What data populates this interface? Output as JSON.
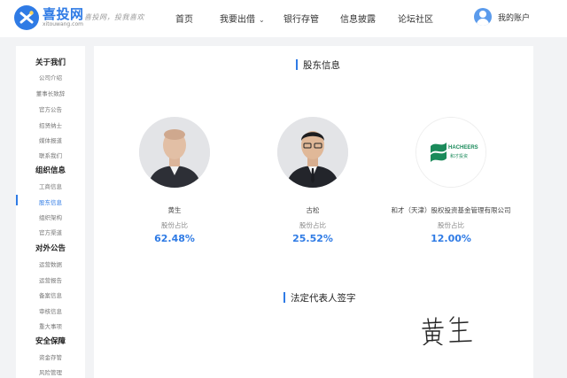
{
  "header": {
    "logo_name": "喜投网",
    "logo_domain": "xitouwang.com",
    "slogan": "喜投网，投我喜欢",
    "nav": [
      {
        "label": "首页",
        "has_dropdown": false
      },
      {
        "label": "我要出借",
        "has_dropdown": true
      },
      {
        "label": "银行存管",
        "has_dropdown": false
      },
      {
        "label": "信息披露",
        "has_dropdown": false
      },
      {
        "label": "论坛社区",
        "has_dropdown": false
      }
    ],
    "account_label": "我的账户"
  },
  "sidebar": {
    "groups": [
      {
        "title": "关于我们",
        "items": [
          {
            "label": "公司介绍",
            "active": false
          },
          {
            "label": "董事长致辞",
            "active": false
          },
          {
            "label": "官方公告",
            "active": false
          },
          {
            "label": "招贤纳士",
            "active": false
          },
          {
            "label": "媒体报道",
            "active": false
          },
          {
            "label": "联系我们",
            "active": false
          }
        ]
      },
      {
        "title": "组织信息",
        "items": [
          {
            "label": "工商信息",
            "active": false
          },
          {
            "label": "股东信息",
            "active": true
          },
          {
            "label": "组织架构",
            "active": false
          },
          {
            "label": "官方渠道",
            "active": false
          }
        ]
      },
      {
        "title": "对外公告",
        "items": [
          {
            "label": "运营数据",
            "active": false
          },
          {
            "label": "运营报告",
            "active": false
          },
          {
            "label": "备案信息",
            "active": false
          },
          {
            "label": "审核信息",
            "active": false
          },
          {
            "label": "重大事项",
            "active": false
          }
        ]
      },
      {
        "title": "安全保障",
        "items": [
          {
            "label": "资金存管",
            "active": false
          },
          {
            "label": "风险管理",
            "active": false
          }
        ]
      }
    ]
  },
  "main": {
    "section_title": "股东信息",
    "holders": [
      {
        "name": "黄生",
        "share_label": "股份占比",
        "share": "62.48%",
        "photo": "person-photo",
        "share_fraction": 0.6248
      },
      {
        "name": "古松",
        "share_label": "股份占比",
        "share": "25.52%",
        "photo": "person-photo",
        "share_fraction": 0.2552
      },
      {
        "name": "和才（天津）股权投资基金管理有限公司",
        "share_label": "股份占比",
        "share": "12.00%",
        "photo": "company-logo",
        "share_fraction": 0.12
      }
    ],
    "company_logo_text": "HACHEERS",
    "company_logo_subtext": "和才投资",
    "legal_rep_title": "法定代表人签字",
    "signature_text": "黄生"
  },
  "colors": {
    "accent": "#2f7be5",
    "page_background": "#f2f3f5",
    "logo_green": "#1a8a5a"
  }
}
